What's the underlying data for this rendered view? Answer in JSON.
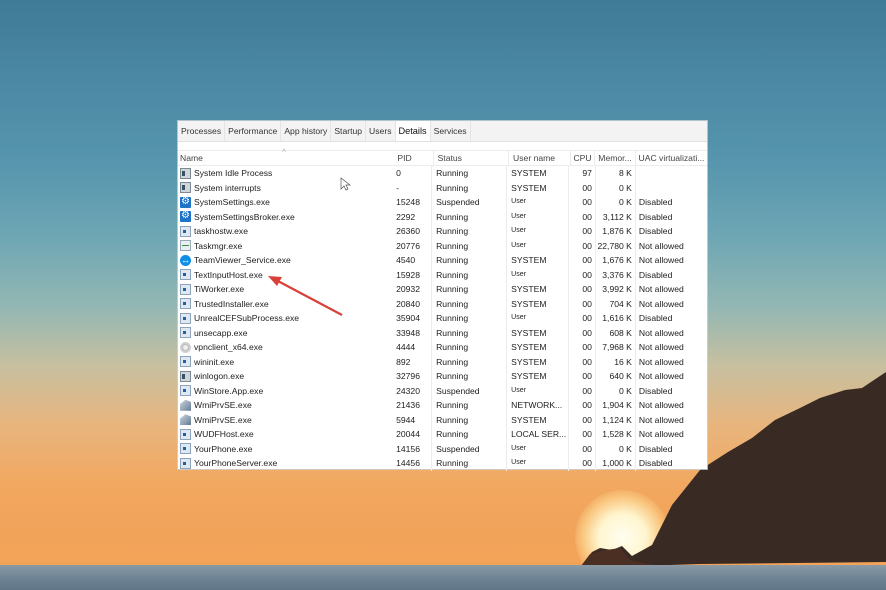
{
  "app": "Task Manager",
  "tabs": [
    {
      "label": "Processes"
    },
    {
      "label": "Performance"
    },
    {
      "label": "App history"
    },
    {
      "label": "Startup"
    },
    {
      "label": "Users"
    },
    {
      "label": "Details",
      "active": true
    },
    {
      "label": "Services"
    }
  ],
  "columns": {
    "name": "Name",
    "pid": "PID",
    "status": "Status",
    "user": "User name",
    "cpu": "CPU",
    "memory": "Memor...",
    "uac": "UAC virtualizati..."
  },
  "rows": [
    {
      "name": "System Idle Process",
      "icon": "system-icon",
      "pid": "0",
      "status": "Running",
      "user": "SYSTEM",
      "cpu": "97",
      "memory": "8 K",
      "uac": ""
    },
    {
      "name": "System interrupts",
      "icon": "system-icon",
      "pid": "-",
      "status": "Running",
      "user": "SYSTEM",
      "cpu": "00",
      "memory": "0 K",
      "uac": ""
    },
    {
      "name": "SystemSettings.exe",
      "icon": "gear-icon",
      "pid": "15248",
      "status": "Suspended",
      "user": "User",
      "cpu": "00",
      "memory": "0 K",
      "uac": "Disabled"
    },
    {
      "name": "SystemSettingsBroker.exe",
      "icon": "gear-icon",
      "pid": "2292",
      "status": "Running",
      "user": "User",
      "cpu": "00",
      "memory": "3,112 K",
      "uac": "Disabled"
    },
    {
      "name": "taskhostw.exe",
      "icon": "window-icon",
      "pid": "26360",
      "status": "Running",
      "user": "User",
      "cpu": "00",
      "memory": "1,876 K",
      "uac": "Disabled"
    },
    {
      "name": "Taskmgr.exe",
      "icon": "task-manager-icon",
      "pid": "20776",
      "status": "Running",
      "user": "User",
      "cpu": "00",
      "memory": "22,780 K",
      "uac": "Not allowed"
    },
    {
      "name": "TeamViewer_Service.exe",
      "icon": "teamviewer-icon",
      "pid": "4540",
      "status": "Running",
      "user": "SYSTEM",
      "cpu": "00",
      "memory": "1,676 K",
      "uac": "Not allowed"
    },
    {
      "name": "TextInputHost.exe",
      "icon": "window-icon",
      "pid": "15928",
      "status": "Running",
      "user": "User",
      "cpu": "00",
      "memory": "3,376 K",
      "uac": "Disabled"
    },
    {
      "name": "TiWorker.exe",
      "icon": "window-icon",
      "pid": "20932",
      "status": "Running",
      "user": "SYSTEM",
      "cpu": "00",
      "memory": "3,992 K",
      "uac": "Not allowed"
    },
    {
      "name": "TrustedInstaller.exe",
      "icon": "window-icon",
      "pid": "20840",
      "status": "Running",
      "user": "SYSTEM",
      "cpu": "00",
      "memory": "704 K",
      "uac": "Not allowed"
    },
    {
      "name": "UnrealCEFSubProcess.exe",
      "icon": "window-icon",
      "pid": "35904",
      "status": "Running",
      "user": "User",
      "cpu": "00",
      "memory": "1,616 K",
      "uac": "Disabled"
    },
    {
      "name": "unsecapp.exe",
      "icon": "window-icon",
      "pid": "33948",
      "status": "Running",
      "user": "SYSTEM",
      "cpu": "00",
      "memory": "608 K",
      "uac": "Not allowed"
    },
    {
      "name": "vpnclient_x64.exe",
      "icon": "vpn-icon",
      "pid": "4444",
      "status": "Running",
      "user": "SYSTEM",
      "cpu": "00",
      "memory": "7,968 K",
      "uac": "Not allowed"
    },
    {
      "name": "wininit.exe",
      "icon": "window-icon",
      "pid": "892",
      "status": "Running",
      "user": "SYSTEM",
      "cpu": "00",
      "memory": "16 K",
      "uac": "Not allowed"
    },
    {
      "name": "winlogon.exe",
      "icon": "system-icon",
      "pid": "32796",
      "status": "Running",
      "user": "SYSTEM",
      "cpu": "00",
      "memory": "640 K",
      "uac": "Not allowed"
    },
    {
      "name": "WinStore.App.exe",
      "icon": "window-icon",
      "pid": "24320",
      "status": "Suspended",
      "user": "User",
      "cpu": "00",
      "memory": "0 K",
      "uac": "Disabled"
    },
    {
      "name": "WmiPrvSE.exe",
      "icon": "wmi-icon",
      "pid": "21436",
      "status": "Running",
      "user": "NETWORK...",
      "cpu": "00",
      "memory": "1,904 K",
      "uac": "Not allowed"
    },
    {
      "name": "WmiPrvSE.exe",
      "icon": "wmi-icon",
      "pid": "5944",
      "status": "Running",
      "user": "SYSTEM",
      "cpu": "00",
      "memory": "1,124 K",
      "uac": "Not allowed"
    },
    {
      "name": "WUDFHost.exe",
      "icon": "window-icon",
      "pid": "20044",
      "status": "Running",
      "user": "LOCAL SER...",
      "cpu": "00",
      "memory": "1,528 K",
      "uac": "Not allowed"
    },
    {
      "name": "YourPhone.exe",
      "icon": "window-icon",
      "pid": "14156",
      "status": "Suspended",
      "user": "User",
      "cpu": "00",
      "memory": "0 K",
      "uac": "Disabled"
    },
    {
      "name": "YourPhoneServer.exe",
      "icon": "window-icon",
      "pid": "14456",
      "status": "Running",
      "user": "User",
      "cpu": "00",
      "memory": "1,000 K",
      "uac": "Disabled"
    }
  ],
  "annotation": {
    "type": "red-arrow",
    "target": "TextInputHost.exe",
    "color": "#d9403a"
  },
  "colors": {
    "accent": "#1e73c8",
    "arrow": "#d9403a"
  }
}
